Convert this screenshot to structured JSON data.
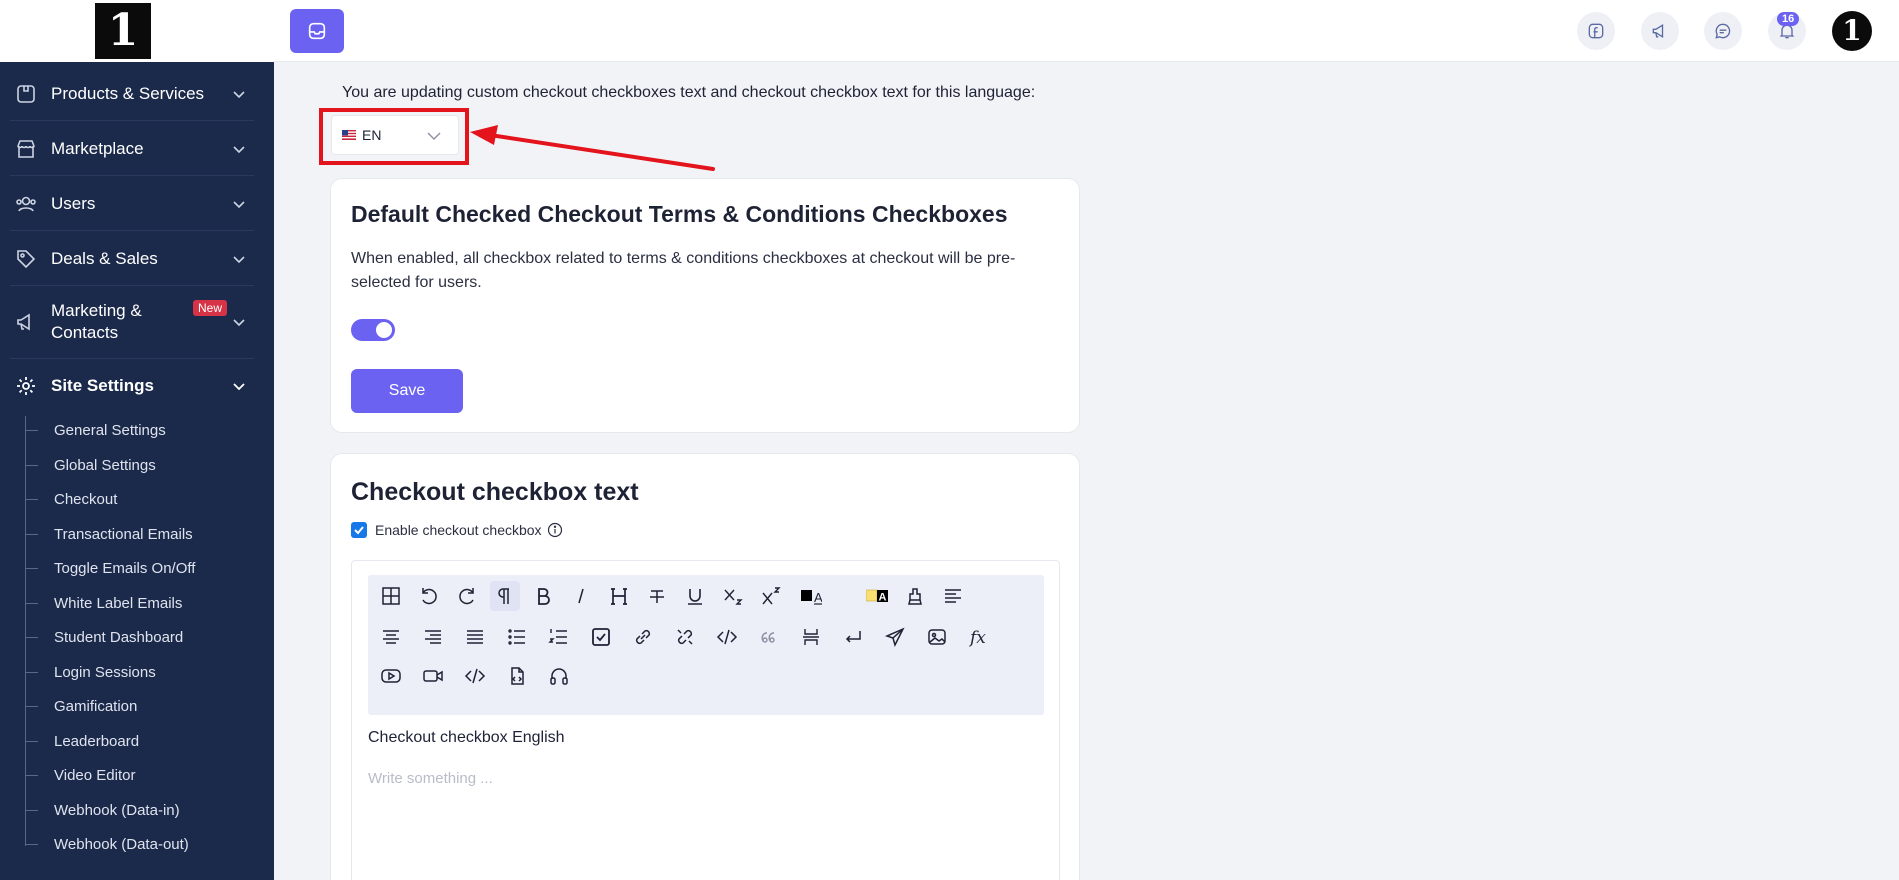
{
  "sidebar": {
    "logo_text": "1",
    "items": [
      {
        "label": "Products & Services",
        "icon": "box-icon"
      },
      {
        "label": "Marketplace",
        "icon": "store-icon"
      },
      {
        "label": "Users",
        "icon": "users-icon"
      },
      {
        "label": "Deals & Sales",
        "icon": "tag-icon"
      },
      {
        "label": "Marketing & Contacts",
        "icon": "megaphone-icon",
        "badge": "New"
      },
      {
        "label": "Site Settings",
        "icon": "gear-icon"
      }
    ],
    "sub_items": [
      "General Settings",
      "Global Settings",
      "Checkout",
      "Transactional Emails",
      "Toggle Emails On/Off",
      "White Label Emails",
      "Student Dashboard",
      "Login Sessions",
      "Gamification",
      "Leaderboard",
      "Video Editor",
      "Webhook (Data-in)",
      "Webhook (Data-out)"
    ]
  },
  "topbar": {
    "notification_count": "16",
    "avatar_text": "1",
    "icons": [
      "facebook-icon",
      "megaphone-icon",
      "chat-icon",
      "bell-icon"
    ]
  },
  "main": {
    "intro_text": "You are updating custom checkout checkboxes text and checkout checkbox text for this language:",
    "language": {
      "code": "EN",
      "flag": "us-flag-icon"
    },
    "default_card": {
      "title": "Default Checked Checkout Terms & Conditions Checkboxes",
      "description": "When enabled, all checkbox related to terms & conditions checkboxes at checkout will be pre-selected for users.",
      "toggle_on": true,
      "save_label": "Save"
    },
    "checkbox_card": {
      "title": "Checkout checkbox text",
      "enable_label": "Enable checkout checkbox",
      "enable_checked": true,
      "editor_content": "Checkout checkbox English",
      "editor_placeholder": "Write something ..."
    }
  },
  "colors": {
    "sidebar_bg": "#1b2a4a",
    "accent": "#6b62f1",
    "highlight_red": "#e3141b",
    "badge_red": "#d63446",
    "checkbox_blue": "#1677e8"
  }
}
